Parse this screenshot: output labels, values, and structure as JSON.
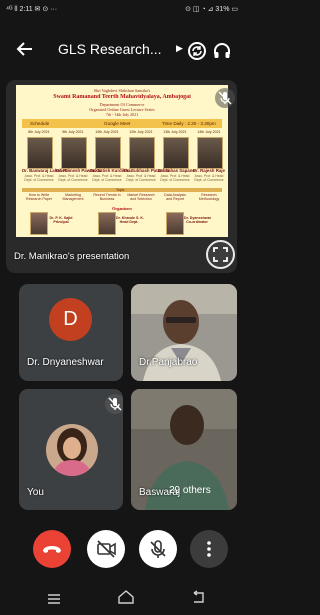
{
  "status_bar": {
    "left_text": "⁴ᴳ ll 2:11 ✉ ⊙ ···",
    "right_text": "⊙ ◫ ◔ ⊿ 31% ▭"
  },
  "header": {
    "title": "GLS Research...",
    "icons": {
      "back": "arrow-left-icon",
      "switch_camera": "camera-switch-icon",
      "audio": "headphones-icon"
    }
  },
  "presentation": {
    "slide": {
      "header_lines": [
        "Shri Vaghdevi Shikshan Sanstha's",
        "Swami Ramanand Teerth Mahavidyalaya, Ambajogai",
        "Department Of Commerce",
        "Organised Online Guest Lecture Series",
        "7th - 14th July 2021"
      ],
      "banner": {
        "schedule": "Schedule",
        "platform": "Google Meet",
        "time": "Time Daily : 2.30 - 3.30pm"
      },
      "dates": [
        "8th July 2021",
        "9th July 2021",
        "10th July 2021",
        "12th July 2021",
        "13th July 2021",
        "14th July 2021"
      ],
      "speakers": [
        {
          "name": "Dr. Baswaraj Lakshetti",
          "desc": "Asso. Prof. & Head Dept. of Commerce"
        },
        {
          "name": "Dr. Ramesh Pawankar",
          "desc": "Asso. Prof. & Head Dept. of Commerce"
        },
        {
          "name": "Dr. Satish Kurdikhar",
          "desc": "Asso. Prof. & Head Dept. of Commerce"
        },
        {
          "name": "Dr. Subhash Patankar",
          "desc": "Asso. Prof. & Head Dept. of Commerce"
        },
        {
          "name": "Dr. Sahas Sapane",
          "desc": "Asso. Prof. & Head Dept. of Commerce"
        },
        {
          "name": "Dr. Rajesh Raje",
          "desc": "Asso. Prof. & Head Dept. of Commerce"
        }
      ],
      "topics_label": "Topic",
      "topics": [
        [
          "How to Write",
          "Research Paper"
        ],
        [
          "Marketing",
          "Management"
        ],
        [
          "Recent Trends in",
          "Business"
        ],
        [
          "Market Research",
          "and Selection"
        ],
        [
          "Data Analysis",
          "and Report"
        ],
        [
          "Research",
          "Methodology"
        ]
      ],
      "organisers_label": "Organisers",
      "organisers": [
        {
          "name": "Dr. P. K. Sajid",
          "role": "Principal"
        },
        {
          "name": "Dr. Khande S. K.",
          "role": "Head Dept."
        },
        {
          "name": "Dr. Dyaneshwar",
          "role": "Co-ordinator"
        }
      ]
    },
    "presenter_label": "Dr. Manikrao's presentation",
    "icons": {
      "muted": "mic-off-icon",
      "fullscreen": "fullscreen-icon"
    }
  },
  "participants": [
    {
      "name": "Dr. Dnyaneshwar",
      "avatar_letter": "D",
      "avatar_color": "#c2401f"
    },
    {
      "name": "Dr.Panjabrao"
    },
    {
      "name": "You"
    },
    {
      "name": "Baswaraj"
    }
  ],
  "others_count_label": "29 others",
  "controls": {
    "end_call": "call-end-icon",
    "camera": "videocam-off-icon",
    "mic": "mic-off-icon",
    "more": "more-vertical-icon"
  },
  "nav": {
    "menu": "recent-apps-icon",
    "home": "home-icon",
    "back": "back-icon"
  },
  "colors": {
    "end_call": "#ea4335",
    "tile": "#3c4043",
    "background": "#151515"
  }
}
